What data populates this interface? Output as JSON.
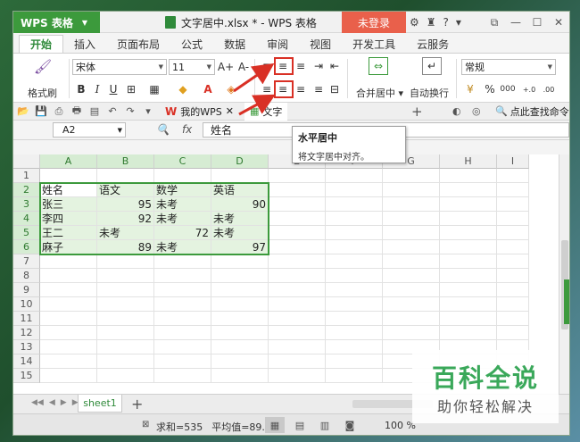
{
  "titlebar": {
    "app_name": "WPS 表格",
    "doc_title": "文字居中.xlsx * - WPS 表格",
    "login": "未登录",
    "icons": [
      "skin-icon",
      "shirt-icon",
      "help-icon"
    ],
    "controls": [
      "minimize",
      "restore",
      "close"
    ]
  },
  "tabs": [
    "开始",
    "插入",
    "页面布局",
    "公式",
    "数据",
    "审阅",
    "视图",
    "开发工具",
    "云服务"
  ],
  "ribbon": {
    "format_painter": "格式刷",
    "font_name": "宋体",
    "font_size": "11",
    "grow_font": "A+",
    "shrink_font": "A-",
    "bold": "B",
    "italic": "I",
    "underline": "U",
    "merge_center": "合并居中",
    "wrap_text": "自动换行",
    "number_format": "常规",
    "percent": "%",
    "comma": "000",
    "accent": "#3c9a3c"
  },
  "quickbar": {
    "wps_tab": "我的WPS",
    "doc_tab": "文字",
    "find_command": "点此查找命令"
  },
  "tooltip": {
    "title": "水平居中",
    "desc": "将文字居中对齐。"
  },
  "formula_bar": {
    "name_box": "A2",
    "fx": "fx",
    "content": "姓名"
  },
  "grid": {
    "columns": [
      "A",
      "B",
      "C",
      "D",
      "E",
      "F",
      "G",
      "H",
      "I"
    ],
    "rows": [
      "1",
      "2",
      "3",
      "4",
      "5",
      "6",
      "7",
      "8",
      "9",
      "10",
      "11",
      "12",
      "13",
      "14",
      "15"
    ],
    "cells": [
      [
        "",
        "",
        "",
        ""
      ],
      [
        "姓名",
        "语文",
        "数学",
        "英语"
      ],
      [
        "张三",
        "95",
        "未考",
        "90"
      ],
      [
        "李四",
        "92",
        "未考",
        "未考"
      ],
      [
        "王二",
        "未考",
        "72",
        "未考"
      ],
      [
        "麻子",
        "89",
        "未考",
        "97"
      ]
    ]
  },
  "sheets": {
    "active": "sheet1",
    "add": "+"
  },
  "status": {
    "sum": "求和=535",
    "avg": "平均值=89....",
    "zoom": "100 %"
  },
  "watermark": {
    "title": "百科全说",
    "subtitle": "助你轻松解决"
  }
}
